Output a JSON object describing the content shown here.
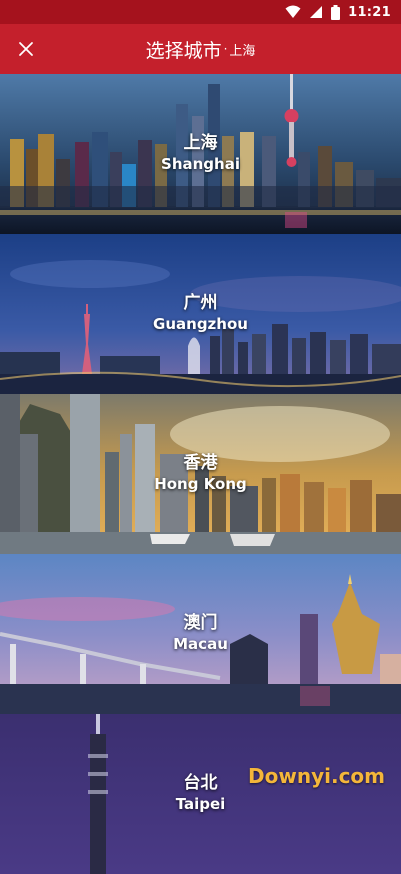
{
  "status_bar": {
    "time": "11:21",
    "icons": [
      "wifi-icon",
      "signal-icon",
      "battery-icon"
    ]
  },
  "header": {
    "close_icon": "close-icon",
    "title": "选择城市",
    "separator": "·",
    "current_city": "上海"
  },
  "cities": [
    {
      "cn": "上海",
      "en": "Shanghai"
    },
    {
      "cn": "广州",
      "en": "Guangzhou"
    },
    {
      "cn": "香港",
      "en": "Hong Kong"
    },
    {
      "cn": "澳门",
      "en": "Macau"
    },
    {
      "cn": "台北",
      "en": "Taipei"
    }
  ],
  "watermark": "Downyi.com",
  "colors": {
    "status_bar": "#a5121d",
    "app_bar": "#c4202c",
    "text": "#ffffff",
    "watermark": "#f4b63a"
  }
}
